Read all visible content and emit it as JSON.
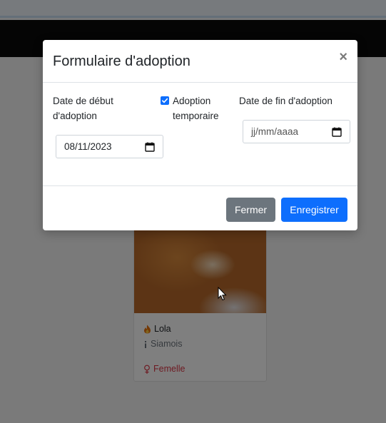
{
  "modal": {
    "title": "Formulaire d'adoption",
    "close_symbol": "×",
    "start_label": "Date de début d'adoption",
    "start_value": "08/11/2023",
    "temporary_label": "Adoption temporaire",
    "temporary_checked": true,
    "end_label": "Date de fin d'adoption",
    "end_placeholder": "jj/mm/aaaa",
    "close_button": "Fermer",
    "save_button": "Enregistrer"
  },
  "pet_card": {
    "name_icon": "flame-icon",
    "name": "Lola",
    "breed_icon": "info-icon",
    "breed": "Siamois",
    "sex_icon": "female-icon",
    "sex": "Femelle"
  },
  "colors": {
    "primary": "#0d6efd",
    "secondary": "#6c757d",
    "danger": "#dc3545",
    "navbar": "#0b0b0b"
  }
}
